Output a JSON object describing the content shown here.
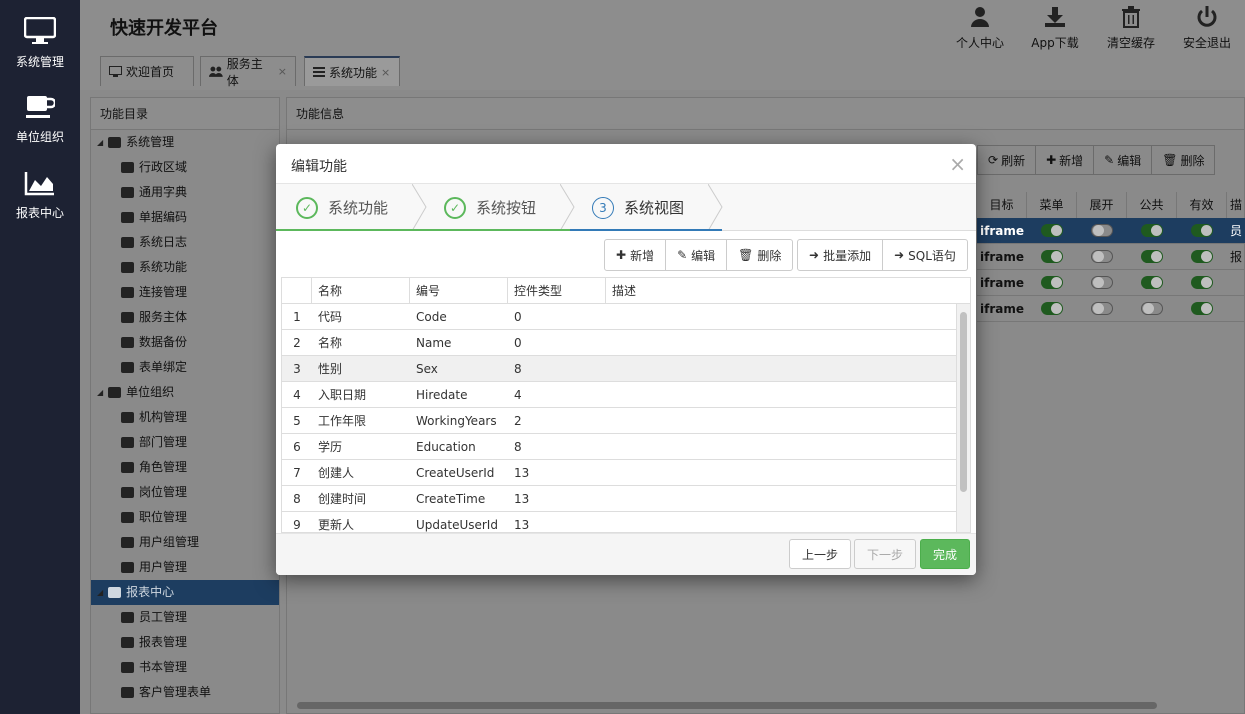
{
  "sidebar": {
    "items": [
      {
        "label": "系统管理",
        "icon": "monitor-icon"
      },
      {
        "label": "单位组织",
        "icon": "coffee-icon"
      },
      {
        "label": "报表中心",
        "icon": "area-chart-icon"
      }
    ]
  },
  "header": {
    "title": "快速开发平台",
    "actions": [
      {
        "label": "个人中心",
        "icon": "user-icon"
      },
      {
        "label": "App下载",
        "icon": "download-icon"
      },
      {
        "label": "清空缓存",
        "icon": "trash-icon"
      },
      {
        "label": "安全退出",
        "icon": "power-icon"
      }
    ]
  },
  "tabs": [
    {
      "label": "欢迎首页"
    },
    {
      "label": "服务主体",
      "close": "×"
    },
    {
      "label": "系统功能",
      "close": "×"
    }
  ],
  "left_panel": {
    "title": "功能目录",
    "tree": [
      {
        "label": "系统管理",
        "level": 0
      },
      {
        "label": "行政区域",
        "level": 1
      },
      {
        "label": "通用字典",
        "level": 1
      },
      {
        "label": "单据编码",
        "level": 1
      },
      {
        "label": "系统日志",
        "level": 1
      },
      {
        "label": "系统功能",
        "level": 1
      },
      {
        "label": "连接管理",
        "level": 1
      },
      {
        "label": "服务主体",
        "level": 1
      },
      {
        "label": "数据备份",
        "level": 1
      },
      {
        "label": "表单绑定",
        "level": 1
      },
      {
        "label": "单位组织",
        "level": 0
      },
      {
        "label": "机构管理",
        "level": 1
      },
      {
        "label": "部门管理",
        "level": 1
      },
      {
        "label": "角色管理",
        "level": 1
      },
      {
        "label": "岗位管理",
        "level": 1
      },
      {
        "label": "职位管理",
        "level": 1
      },
      {
        "label": "用户组管理",
        "level": 1
      },
      {
        "label": "用户管理",
        "level": 1
      },
      {
        "label": "报表中心",
        "level": 0,
        "selected": true
      },
      {
        "label": "员工管理",
        "level": 1
      },
      {
        "label": "报表管理",
        "level": 1
      },
      {
        "label": "书本管理",
        "level": 1
      },
      {
        "label": "客户管理表单",
        "level": 1
      }
    ]
  },
  "right_panel": {
    "title": "功能信息",
    "toolbar": [
      "刷新",
      "新增",
      "编辑",
      "删除"
    ],
    "columns": [
      "目标",
      "菜单",
      "展开",
      "公共",
      "有效",
      "描"
    ],
    "rows": [
      {
        "target": "iframe",
        "menu": true,
        "expand": false,
        "public": true,
        "valid": true,
        "desc": "员",
        "selected": true
      },
      {
        "target": "iframe",
        "menu": true,
        "expand": false,
        "public": true,
        "valid": true,
        "desc": "报"
      },
      {
        "target": "iframe",
        "menu": true,
        "expand": false,
        "public": true,
        "valid": true,
        "desc": ""
      },
      {
        "target": "iframe",
        "menu": true,
        "expand": false,
        "public": false,
        "valid": true,
        "desc": ""
      }
    ]
  },
  "modal": {
    "title": "编辑功能",
    "close": "×",
    "steps": [
      {
        "num": "✓",
        "label": "系统功能",
        "done": true
      },
      {
        "num": "✓",
        "label": "系统按钮",
        "done": true
      },
      {
        "num": "3",
        "label": "系统视图",
        "current": true
      }
    ],
    "toolbar1": [
      "新增",
      "编辑",
      "删除"
    ],
    "toolbar2": [
      "批量添加",
      "SQL语句"
    ],
    "columns": [
      "名称",
      "编号",
      "控件类型",
      "描述"
    ],
    "rows": [
      {
        "n": "1",
        "name": "代码",
        "code": "Code",
        "type": "0"
      },
      {
        "n": "2",
        "name": "名称",
        "code": "Name",
        "type": "0"
      },
      {
        "n": "3",
        "name": "性别",
        "code": "Sex",
        "type": "8"
      },
      {
        "n": "4",
        "name": "入职日期",
        "code": "Hiredate",
        "type": "4"
      },
      {
        "n": "5",
        "name": "工作年限",
        "code": "WorkingYears",
        "type": "2"
      },
      {
        "n": "6",
        "name": "学历",
        "code": "Education",
        "type": "8"
      },
      {
        "n": "7",
        "name": "创建人",
        "code": "CreateUserId",
        "type": "13"
      },
      {
        "n": "8",
        "name": "创建时间",
        "code": "CreateTime",
        "type": "13"
      },
      {
        "n": "9",
        "name": "更新人",
        "code": "UpdateUserId",
        "type": "13"
      }
    ],
    "footer": {
      "prev": "上一步",
      "next": "下一步",
      "finish": "完成"
    }
  }
}
